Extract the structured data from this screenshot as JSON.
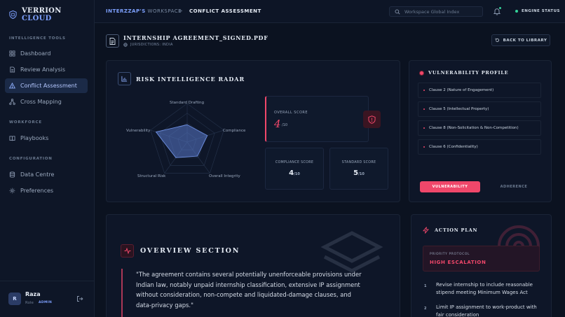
{
  "brand": {
    "name_main": "VERRION",
    "name_accent": "CLOUD"
  },
  "sidebar": {
    "sections": [
      {
        "title": "INTELLIGENCE TOOLS"
      },
      {
        "title": "WORKFORCE"
      },
      {
        "title": "CONFIGURATION"
      }
    ],
    "items": [
      {
        "label": "Dashboard",
        "icon": "grid-icon"
      },
      {
        "label": "Review Analysis",
        "icon": "document-icon"
      },
      {
        "label": "Conflict Assessment",
        "icon": "warning-icon",
        "active": true
      },
      {
        "label": "Cross Mapping",
        "icon": "network-icon"
      },
      {
        "label": "Playbooks",
        "icon": "book-icon"
      },
      {
        "label": "Data Centre",
        "icon": "database-icon"
      },
      {
        "label": "Preferences",
        "icon": "gear-icon"
      }
    ]
  },
  "user": {
    "initial": "R",
    "name": "Raza",
    "role": "Role",
    "badge": "ADMIN"
  },
  "topbar": {
    "workspace_name": "INTERZZAP'S",
    "workspace_suffix": " WORKSPACE",
    "separator": ">",
    "current": "CONFLICT ASSESSMENT",
    "search_placeholder": "Workspace Global Index",
    "engine_status": "ENGINE STATUS"
  },
  "file": {
    "title": "INTERNSHIP AGREEMENT_SIGNED.PDF",
    "jurisdiction": "JURISDICTIONS: INDIA",
    "back_label": "BACK TO LIBRARY"
  },
  "radar": {
    "title": "RISK INTELLIGENCE RADAR",
    "axes": [
      "Standard Drafting",
      "Compliance",
      "Overall Integrity",
      "Structural Risk",
      "Vulnerability"
    ],
    "values": [
      0.45,
      0.55,
      0.45,
      0.5,
      0.85
    ]
  },
  "scores": {
    "overall_label": "OVERALL SCORE",
    "overall_value": "4",
    "overall_denominator": "/10",
    "compliance_label": "COMPLIANCE SCORE",
    "compliance_value": "4",
    "compliance_denominator": "/10",
    "standard_label": "STANDARD SCORE",
    "standard_value": "5",
    "standard_denominator": "/10"
  },
  "vulnerability": {
    "title": "VULNERABILITY PROFILE",
    "clauses": [
      "Clause 2 (Nature of Engagement)",
      "Clause 5 (Intellectual Property)",
      "Clause 8 (Non-Solicitation & Non-Competition)",
      "Clause 6 (Confidentiality)"
    ],
    "tab_active": "VULNERABILITY",
    "tab_inactive": "ADHERENCE"
  },
  "overview": {
    "title": "OVERVIEW SECTION",
    "quote": "\"The agreement contains several potentially unenforceable provisions under Indian law, notably unpaid internship classification, extensive IP assignment without consideration, non-compete and liquidated-damage clauses, and data-privacy gaps.\""
  },
  "action_plan": {
    "title": "ACTION PLAN",
    "priority_label": "PRIORITY PROTOCOL",
    "priority_value": "HIGH ESCALATION",
    "items": [
      {
        "num": "1",
        "text": "Revise internship to include reasonable stipend meeting Minimum Wages Act"
      },
      {
        "num": "2",
        "text": "Limit IP assignment to work-product with fair consideration"
      }
    ]
  },
  "colors": {
    "accent": "#7ea1ff",
    "danger": "#f0476a",
    "success": "#34d399",
    "background": "#0b1220"
  }
}
